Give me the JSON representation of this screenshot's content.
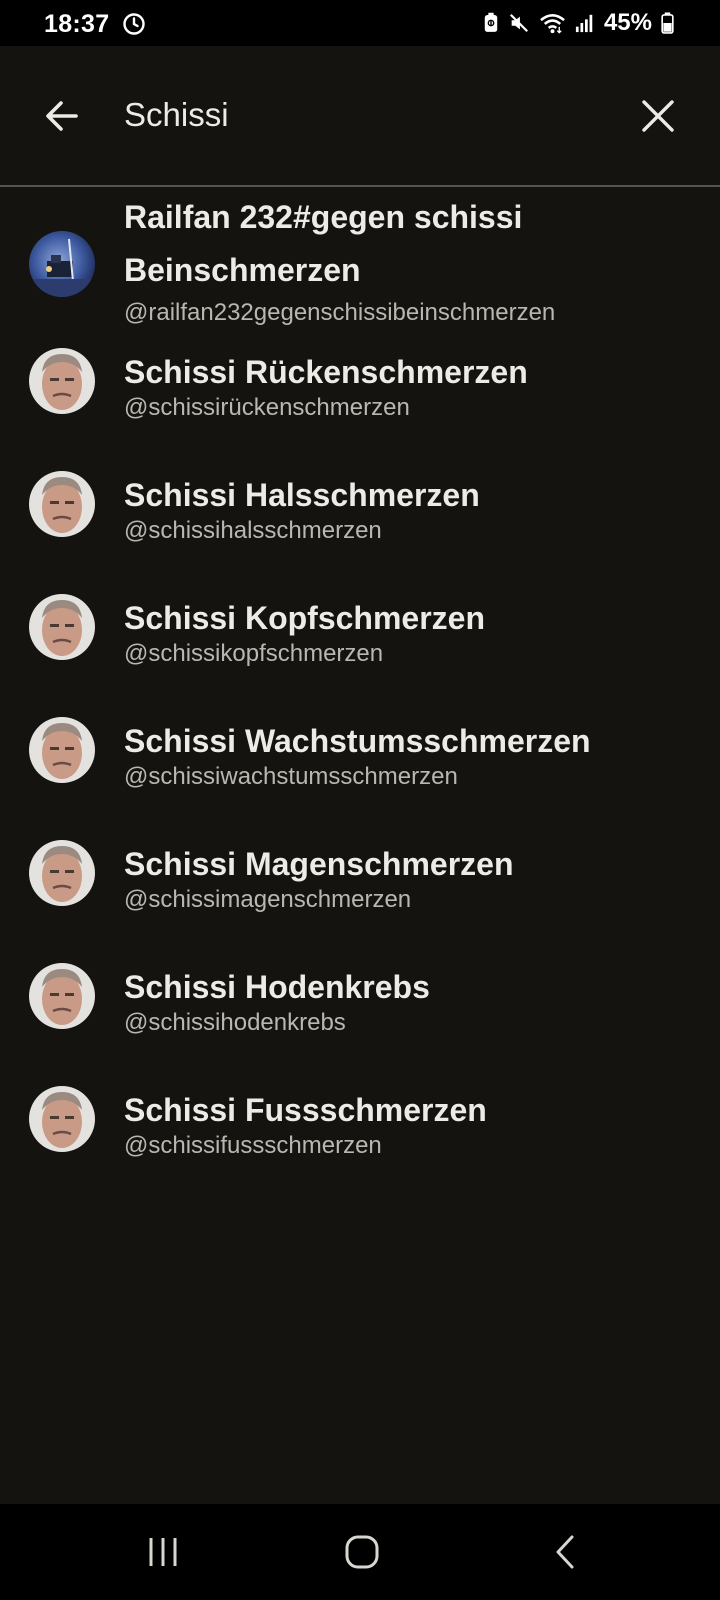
{
  "status_bar": {
    "time": "18:37",
    "battery_percent": "45%",
    "icons": [
      "alarm-icon",
      "battery-saver-icon",
      "mute-icon",
      "wifi-icon",
      "signal-icon",
      "battery-icon"
    ]
  },
  "search": {
    "query": "Schissi",
    "back_icon": "arrow-left-icon",
    "clear_icon": "close-icon"
  },
  "results": [
    {
      "name": "Railfan 232#gegen schissi Beinschmerzen",
      "handle": "@railfan232gegenschissibeinschmerzen",
      "avatar": "train-photo"
    },
    {
      "name": "Schissi Rückenschmerzen",
      "handle": "@schissirückenschmerzen",
      "avatar": "face-photo"
    },
    {
      "name": "Schissi Halsschmerzen",
      "handle": "@schissihalsschmerzen",
      "avatar": "face-photo"
    },
    {
      "name": "Schissi Kopfschmerzen",
      "handle": "@schissikopfschmerzen",
      "avatar": "face-photo"
    },
    {
      "name": "Schissi Wachstumsschmerzen",
      "handle": "@schissiwachstumsschmerzen",
      "avatar": "face-photo"
    },
    {
      "name": "Schissi Magenschmerzen",
      "handle": "@schissimagenschmerzen",
      "avatar": "face-photo"
    },
    {
      "name": "Schissi Hodenkrebs",
      "handle": "@schissihodenkrebs",
      "avatar": "face-photo"
    },
    {
      "name": "Schissi Fussschmerzen",
      "handle": "@schissifussschmerzen",
      "avatar": "face-photo"
    }
  ],
  "nav_bar": {
    "icons": [
      "recent-apps-icon",
      "home-icon",
      "back-icon"
    ]
  },
  "colors": {
    "background": "#141310",
    "text_primary": "#ecebe6",
    "text_secondary": "#b9b7b0",
    "divider": "#56544e"
  }
}
